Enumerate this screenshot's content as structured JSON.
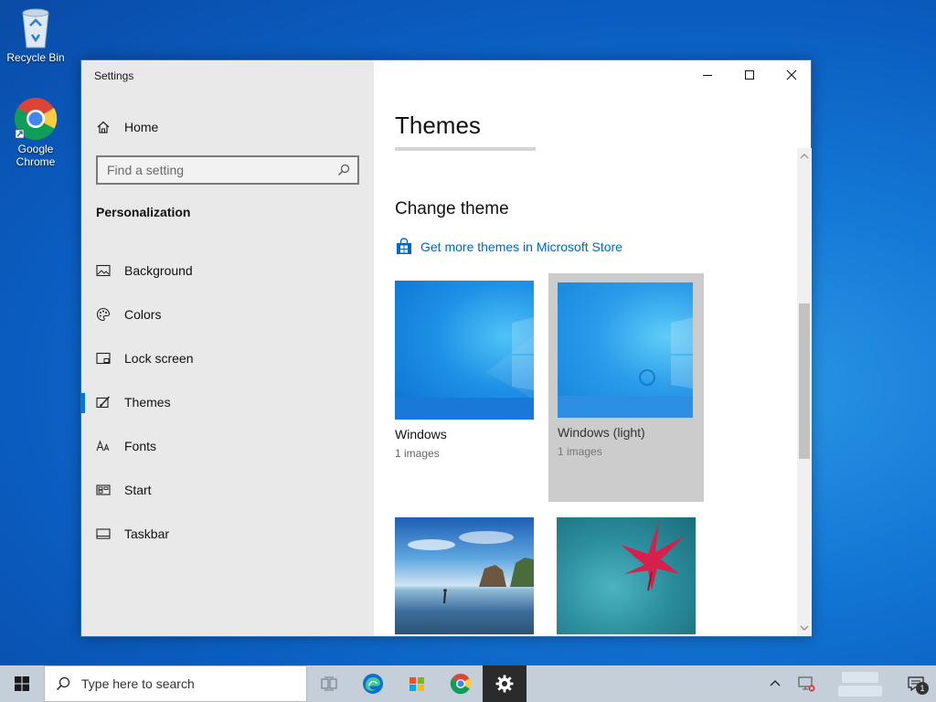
{
  "desktop": {
    "icons": [
      {
        "label": "Recycle Bin"
      },
      {
        "label": "Google Chrome"
      }
    ]
  },
  "window": {
    "title": "Settings",
    "controls": [
      "minimize",
      "maximize",
      "close"
    ]
  },
  "sidebar": {
    "home_label": "Home",
    "search_placeholder": "Find a setting",
    "section_title": "Personalization",
    "items": [
      {
        "label": "Background",
        "icon": "picture-icon"
      },
      {
        "label": "Colors",
        "icon": "palette-icon"
      },
      {
        "label": "Lock screen",
        "icon": "lock-screen-icon"
      },
      {
        "label": "Themes",
        "icon": "brush-icon",
        "active": true
      },
      {
        "label": "Fonts",
        "icon": "fonts-icon"
      },
      {
        "label": "Start",
        "icon": "start-menu-icon"
      },
      {
        "label": "Taskbar",
        "icon": "taskbar-icon"
      }
    ]
  },
  "main": {
    "page_title": "Themes",
    "section_title": "Change theme",
    "store_link": "Get more themes in Microsoft Store",
    "themes": [
      {
        "name": "Windows",
        "count": "1 images"
      },
      {
        "name": "Windows (light)",
        "count": "1 images"
      },
      {
        "name": "",
        "count": ""
      },
      {
        "name": "",
        "count": ""
      }
    ]
  },
  "taskbar": {
    "search_placeholder": "Type here to search",
    "notification_count": "1"
  },
  "colors": {
    "accent": "#0078d4",
    "link": "#0067c0",
    "sidebar_bg": "#e9e9e9",
    "taskbar_bg": "#c4cfda"
  }
}
